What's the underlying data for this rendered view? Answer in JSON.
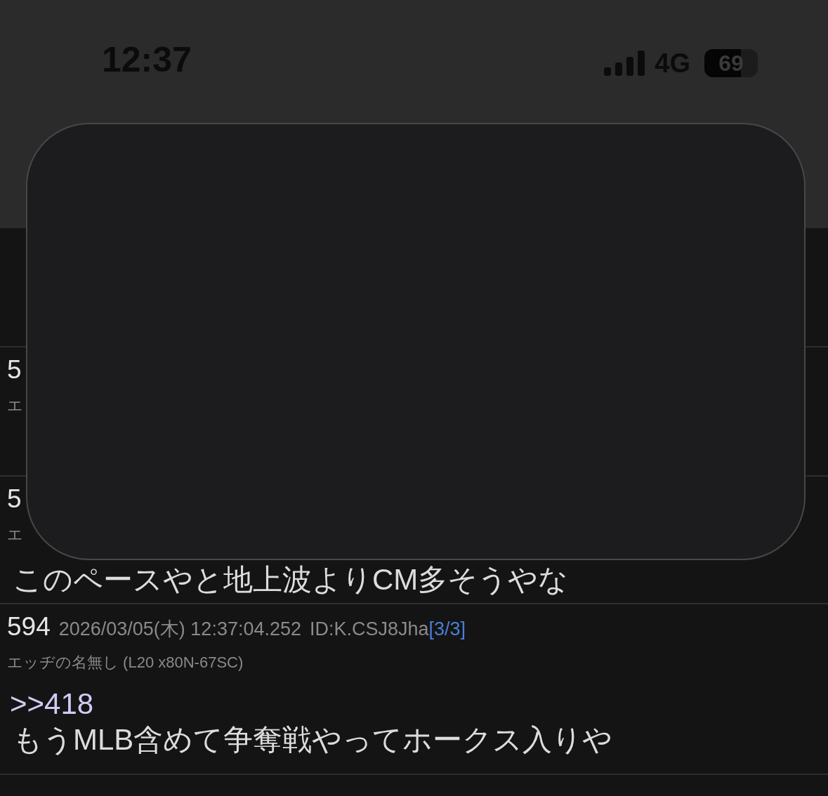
{
  "status_bar": {
    "time": "12:37",
    "network": "4G",
    "battery": "69"
  },
  "posts": [
    {
      "number": "5",
      "name": "エ"
    },
    {
      "number": "5",
      "name": "エ",
      "body": "このペースやと地上波よりCM多そうやな"
    },
    {
      "number": "594",
      "date": "2026/03/05(木) 12:37:04.252",
      "id": "ID:K.CSJ8Jha",
      "count": "[3/3]",
      "name": "エッヂの名無し (L20 x80N-67SC)",
      "reply": ">>418",
      "body": "もうMLB含めて争奪戦やってホークス入りや"
    }
  ]
}
